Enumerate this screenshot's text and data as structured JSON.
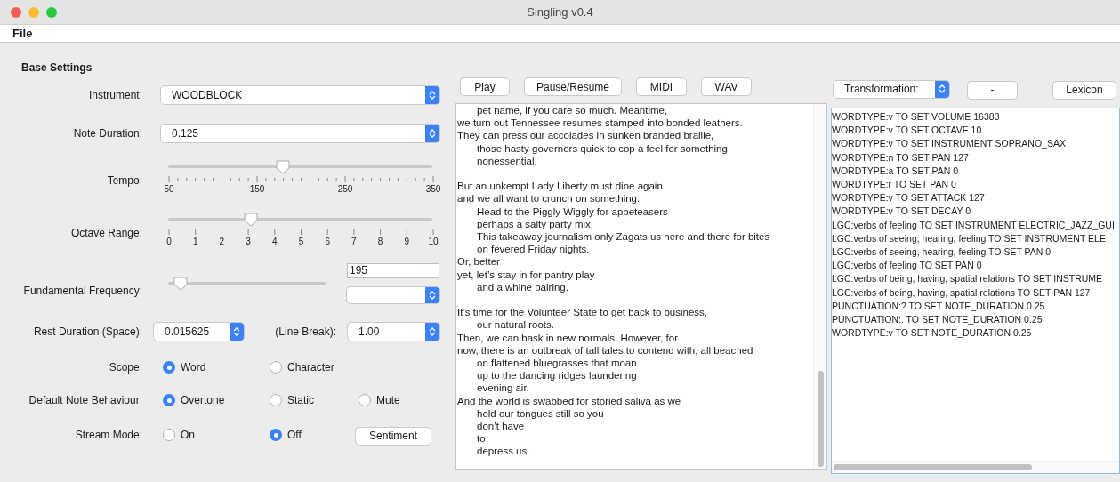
{
  "window": {
    "title": "Singling v0.4"
  },
  "menu": [
    "File"
  ],
  "base_settings": {
    "title": "Base Settings",
    "instrument": {
      "label": "Instrument:",
      "value": "WOODBLOCK"
    },
    "note_duration": {
      "label": "Note Duration:",
      "value": "0.125"
    },
    "tempo": {
      "label": "Tempo:",
      "level": 0.43,
      "tick_labels": [
        "50",
        "150",
        "250",
        "350"
      ]
    },
    "octave_range": {
      "label": "Octave Range:",
      "level": 0.3,
      "tick_labels": [
        "0",
        "1",
        "2",
        "3",
        "4",
        "5",
        "6",
        "7",
        "8",
        "9",
        "10"
      ]
    },
    "fundamental_frequency": {
      "label": "Fundamental Frequency:",
      "level": 0.03,
      "value": "195"
    },
    "rest_duration": {
      "label": "Rest Duration (Space):",
      "value": "0.015625"
    },
    "line_break": {
      "label": "(Line Break):",
      "value": "1.00"
    },
    "radio_groups": [
      {
        "label": "Scope:",
        "options": [
          {
            "label": "Word",
            "selected": true
          },
          {
            "label": "Character",
            "selected": false
          }
        ]
      },
      {
        "label": "Default Note Behaviour:",
        "options": [
          {
            "label": "Overtone",
            "selected": true
          },
          {
            "label": "Static",
            "selected": false
          },
          {
            "label": "Mute",
            "selected": false
          }
        ]
      },
      {
        "label": "Stream Mode:",
        "options": [
          {
            "label": "On",
            "selected": false
          },
          {
            "label": "Off",
            "selected": true
          }
        ],
        "button": "Sentiment"
      }
    ]
  },
  "player_buttons": [
    "Play",
    "Pause/Resume",
    "MIDI",
    "WAV"
  ],
  "poem": [
    [
      {
        "text": "pet name, if you care so much. Meantime,",
        "indented": true
      },
      {
        "text": "we turn out Tennessee resumes stamped into bonded leathers.",
        "indented": false
      },
      {
        "text": "They can press our accolades in sunken branded braille,",
        "indented": false
      },
      {
        "text": "those hasty governors quick to cop a feel for something",
        "indented": true
      },
      {
        "text": "nonessential.",
        "indented": true
      }
    ],
    [
      {
        "text": "But an unkempt Lady Liberty must dine again",
        "indented": false
      },
      {
        "text": "and we all want to crunch on something.",
        "indented": false
      },
      {
        "text": "Head to the Piggly Wiggly for appeteasers –",
        "indented": true
      },
      {
        "text": "perhaps a salty party mix.",
        "indented": true
      },
      {
        "text": "This takeaway journalism only Zagats us here and there for bites",
        "indented": true
      },
      {
        "text": "on fevered Friday nights.",
        "indented": true
      },
      {
        "text": "Or, better",
        "indented": false
      },
      {
        "text": "yet, let’s stay in for pantry play",
        "indented": false
      },
      {
        "text": "and a whine pairing.",
        "indented": true
      }
    ],
    [
      {
        "text": "It’s time for the Volunteer State to get back to business,",
        "indented": false
      },
      {
        "text": "our natural roots.",
        "indented": true
      },
      {
        "text": "Then, we can bask in new normals. However, for",
        "indented": false
      },
      {
        "text": "now, there is an outbreak of tall tales to contend with, all beached",
        "indented": false
      },
      {
        "text": "on flattened bluegrasses that moan",
        "indented": true
      },
      {
        "text": "up to the dancing ridges laundering",
        "indented": true
      },
      {
        "text": "evening air.",
        "indented": true
      },
      {
        "text": "And the world is swabbed for storied saliva as we",
        "indented": false
      },
      {
        "text": "hold our tongues still so you",
        "indented": true
      },
      {
        "text": "don’t have",
        "indented": true
      },
      {
        "text": "to",
        "indented": true
      },
      {
        "text": "depress us.",
        "indented": true
      }
    ]
  ],
  "transformation": {
    "label": "Transformation:",
    "remove_button": "-",
    "lexicon_button": "Lexicon"
  },
  "rules": [
    "WORDTYPE:v TO SET VOLUME 16383",
    "WORDTYPE:v TO SET OCTAVE 10",
    "WORDTYPE:v TO SET INSTRUMENT SOPRANO_SAX",
    "WORDTYPE:n TO SET PAN 127",
    "WORDTYPE:a TO SET PAN 0",
    "WORDTYPE:r TO SET PAN 0",
    "WORDTYPE:v TO SET ATTACK 127",
    "WORDTYPE:v TO SET DECAY 0",
    "LGC:verbs of feeling TO SET INSTRUMENT ELECTRIC_JAZZ_GUI",
    "LGC:verbs of seeing, hearing, feeling TO SET INSTRUMENT ELE",
    "LGC:verbs of seeing, hearing, feeling TO SET PAN 0",
    "LGC:verbs of feeling TO SET PAN 0",
    "LGC:verbs of being, having, spatial relations TO SET INSTRUME",
    "LGC:verbs of being, having, spatial relations TO SET PAN 127",
    "PUNCTUATION:? TO SET NOTE_DURATION 0.25",
    "PUNCTUATION:. TO SET NOTE_DURATION 0.25",
    "WORDTYPE:v TO SET NOTE_DURATION 0.25"
  ]
}
